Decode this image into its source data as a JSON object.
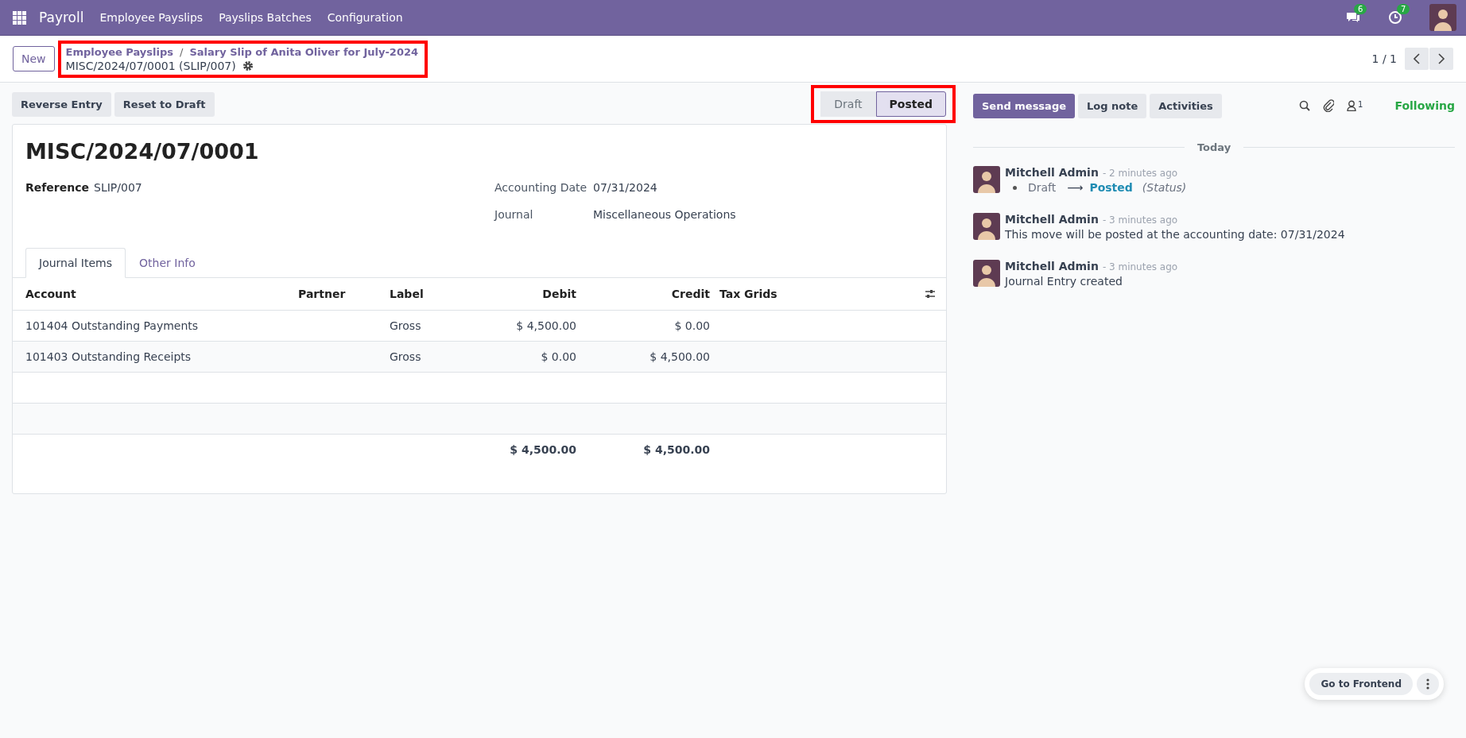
{
  "navbar": {
    "app": "Payroll",
    "menu": [
      "Employee Payslips",
      "Payslips Batches",
      "Configuration"
    ],
    "messages_badge": "6",
    "activities_badge": "7"
  },
  "control_panel": {
    "new_button": "New",
    "breadcrumb": [
      "Employee Payslips",
      "Salary Slip of Anita Oliver for July-2024"
    ],
    "separator": "/",
    "record": "MISC/2024/07/0001 (SLIP/007)",
    "highlighted": true,
    "pager": "1 / 1"
  },
  "actions": [
    "Reverse Entry",
    "Reset to Draft"
  ],
  "statusbar": {
    "highlighted": true,
    "stages": [
      {
        "label": "Draft",
        "selected": false
      },
      {
        "label": "Posted",
        "selected": true
      }
    ]
  },
  "form": {
    "title": "MISC/2024/07/0001",
    "fields_left": [
      {
        "label": "Reference",
        "value": "SLIP/007"
      }
    ],
    "fields_right": [
      {
        "label": "Accounting Date",
        "value": "07/31/2024"
      },
      {
        "label": "Journal",
        "value": "Miscellaneous Operations"
      }
    ],
    "tabs": [
      {
        "label": "Journal Items",
        "selected": true
      },
      {
        "label": "Other Info",
        "selected": false
      }
    ],
    "table": {
      "columns": [
        {
          "label": "Account",
          "kind": "text"
        },
        {
          "label": "Partner",
          "kind": "text"
        },
        {
          "label": "Label",
          "kind": "text"
        },
        {
          "label": "Debit",
          "kind": "money"
        },
        {
          "label": "Credit",
          "kind": "money"
        },
        {
          "label": "Tax Grids",
          "kind": "text"
        }
      ],
      "rows": [
        {
          "account": "101404 Outstanding Payments",
          "label": "Gross",
          "debit": "$ 4,500.00",
          "credit": "$ 0.00"
        },
        {
          "account": "101403 Outstanding Receipts",
          "label": "Gross",
          "debit": "$ 0.00",
          "credit": "$ 4,500.00"
        }
      ],
      "totals": {
        "debit": "$ 4,500.00",
        "credit": "$ 4,500.00"
      }
    }
  },
  "chatter": {
    "buttons": [
      {
        "label": "Send message",
        "primary": true
      },
      {
        "label": "Log note",
        "primary": false
      },
      {
        "label": "Activities",
        "primary": false
      }
    ],
    "followers_count": "1",
    "following": "Following",
    "date_separator": "Today",
    "messages": [
      {
        "kind": "tracking",
        "author": "Mitchell Admin",
        "time": "- 2 minutes ago",
        "old": "Draft",
        "arrow": "⟶",
        "new": "Posted",
        "field": "(Status)"
      },
      {
        "kind": "text",
        "author": "Mitchell Admin",
        "time": "- 3 minutes ago",
        "body": "This move will be posted at the accounting date: 07/31/2024"
      },
      {
        "kind": "text",
        "author": "Mitchell Admin",
        "time": "- 3 minutes ago",
        "body": "Journal Entry created"
      }
    ]
  },
  "floating": {
    "button": "Go to Frontend"
  }
}
